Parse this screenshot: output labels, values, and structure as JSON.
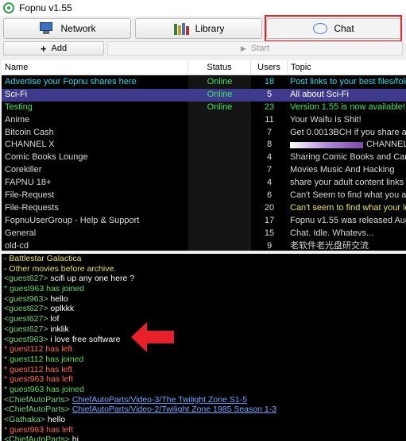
{
  "window": {
    "title": "Fopnu v1.55"
  },
  "tabs": {
    "network_label": "Network",
    "library_label": "Library",
    "chat_label": "Chat"
  },
  "toolbar": {
    "add_label": "Add",
    "start_label": "Start"
  },
  "table": {
    "columns": [
      "Name",
      "Status",
      "Users",
      "Topic"
    ],
    "rows": [
      {
        "name": "Advertise your Fopnu shares here",
        "status": "Online",
        "users": "18",
        "topic": "Post links to your best files/folders",
        "color": "#33d6e6"
      },
      {
        "name": "Sci-Fi",
        "status": "Online",
        "users": "5",
        "topic": "All about Sci-Fi",
        "color": "#ffffff",
        "selected": true
      },
      {
        "name": "Testing",
        "status": "Online",
        "users": "23",
        "topic": "Version 1.55 is now available! https",
        "color": "#3ee06a"
      },
      {
        "name": "Anime",
        "status": "",
        "users": "11",
        "topic": "Your Waifu Is Shit!",
        "color": "#d9d9d9"
      },
      {
        "name": "Bitcoin Cash",
        "status": "",
        "users": "7",
        "topic": "Get 0.0013BCH if you share at least",
        "color": "#d9d9d9"
      },
      {
        "name": "CHANNEL X",
        "status": "",
        "users": "8",
        "topic": "CHANNEL",
        "color": "#d9d9d9",
        "topic_prefix_bar": true
      },
      {
        "name": "Comic Books Lounge",
        "status": "",
        "users": "4",
        "topic": "Sharing Comic Books and Cartoons",
        "color": "#d9d9d9"
      },
      {
        "name": "Corekiller",
        "status": "",
        "users": "7",
        "topic": "Movies Music And Hacking",
        "color": "#d9d9d9"
      },
      {
        "name": "FAPNU 18+",
        "status": "",
        "users": "4",
        "topic": "share your adult content links here",
        "color": "#d9d9d9"
      },
      {
        "name": "File-Request",
        "status": "",
        "users": "6",
        "topic": "Can't Seem to find what you are looking",
        "color": "#d9d9d9"
      },
      {
        "name": "File-Requests",
        "status": "",
        "users": "20",
        "topic": "Can't seem to find what your looking",
        "color": "#d9d9d9",
        "topic_color": "#e8e060"
      },
      {
        "name": "FopnuUserGroup - Help & Support",
        "status": "",
        "users": "17",
        "topic": "Fopnu v1.55 was released August",
        "color": "#d9d9d9"
      },
      {
        "name": "General",
        "status": "",
        "users": "15",
        "topic": "Chat. Idle. Whatevs...",
        "color": "#d9d9d9"
      },
      {
        "name": "old-cd",
        "status": "",
        "users": "9",
        "topic": "老软件老光盘研交流",
        "color": "#d9d9d9"
      }
    ]
  },
  "chat_log": [
    {
      "parts": [
        {
          "t": "- Battlestar Galactica",
          "c": "txt-yellow"
        }
      ]
    },
    {
      "parts": [
        {
          "t": "- Other movies before archive.",
          "c": "txt-yellow"
        }
      ]
    },
    {
      "parts": [
        {
          "t": "<guest627>",
          "c": "nick"
        },
        {
          "t": " scifi up  any one here ?",
          "c": "txt-white"
        }
      ]
    },
    {
      "parts": [
        {
          "t": "* guest963 has joined",
          "c": "txt-green"
        }
      ]
    },
    {
      "parts": [
        {
          "t": "<guest963>",
          "c": "nick"
        },
        {
          "t": " hello",
          "c": "txt-white"
        }
      ]
    },
    {
      "parts": [
        {
          "t": "<guest627>",
          "c": "nick"
        },
        {
          "t": " oplkkk",
          "c": "txt-white"
        }
      ]
    },
    {
      "parts": [
        {
          "t": "<guest627>",
          "c": "nick"
        },
        {
          "t": " lof",
          "c": "txt-white"
        }
      ]
    },
    {
      "parts": [
        {
          "t": "<guest627>",
          "c": "nick"
        },
        {
          "t": " inklik",
          "c": "txt-white"
        }
      ]
    },
    {
      "parts": [
        {
          "t": "<guest963>",
          "c": "nick"
        },
        {
          "t": " i love free software",
          "c": "txt-white"
        }
      ]
    },
    {
      "parts": [
        {
          "t": "* guest112 has left",
          "c": "txt-red"
        }
      ]
    },
    {
      "parts": [
        {
          "t": "* guest112 has joined",
          "c": "txt-green"
        }
      ]
    },
    {
      "parts": [
        {
          "t": "* guest112 has left",
          "c": "txt-red"
        }
      ]
    },
    {
      "parts": [
        {
          "t": "* guest963 has left",
          "c": "txt-red"
        }
      ]
    },
    {
      "parts": [
        {
          "t": "* guest963 has joined",
          "c": "txt-green"
        }
      ]
    },
    {
      "parts": [
        {
          "t": "<ChiefAutoParts>",
          "c": "nick"
        },
        {
          "t": " ",
          "c": "txt-white"
        },
        {
          "t": "ChiefAutoParts/Video-3/The Twilight Zone S1-5",
          "c": "link"
        }
      ]
    },
    {
      "parts": [
        {
          "t": "<ChiefAutoParts>",
          "c": "nick"
        },
        {
          "t": " ",
          "c": "txt-white"
        },
        {
          "t": "ChiefAutoParts/Video-2/Twilight Zone 1985 Season 1-3",
          "c": "link"
        }
      ]
    },
    {
      "parts": [
        {
          "t": "<Gathaka>",
          "c": "nick"
        },
        {
          "t": " hello",
          "c": "txt-white"
        }
      ]
    },
    {
      "parts": [
        {
          "t": "* guest963 has left",
          "c": "txt-red"
        }
      ]
    },
    {
      "parts": [
        {
          "t": "<ChiefAutoParts>",
          "c": "nick"
        },
        {
          "t": " hi",
          "c": "txt-white"
        }
      ]
    }
  ],
  "colors": {
    "highlight_box": "#e02a2a",
    "arrow": "#e8202a",
    "selected_row": "#3f3b8c"
  }
}
